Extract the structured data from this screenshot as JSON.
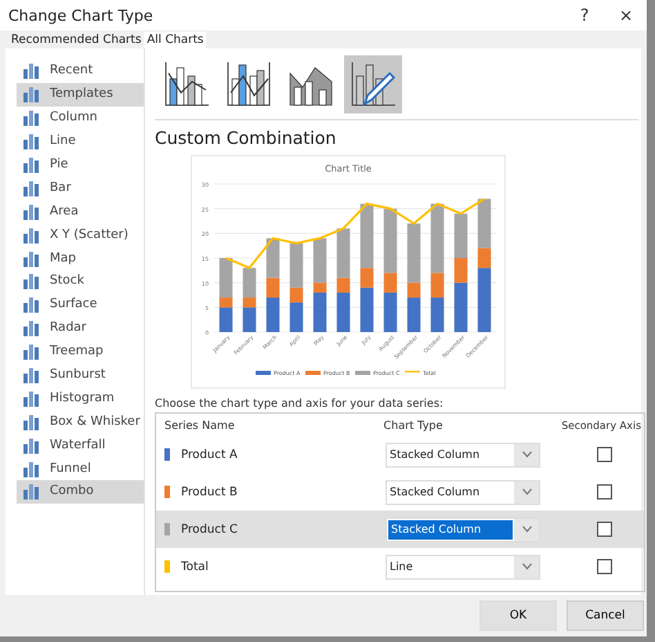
{
  "window": {
    "title": "Change Chart Type",
    "help": "?",
    "close": "×"
  },
  "tabs": [
    {
      "label": "Recommended Charts",
      "selected": false
    },
    {
      "label": "All Charts",
      "selected": true
    }
  ],
  "sidebar": {
    "items": [
      {
        "label": "Recent",
        "selected": false
      },
      {
        "label": "Templates",
        "selected": true
      },
      {
        "label": "Column",
        "selected": false
      },
      {
        "label": "Line",
        "selected": false
      },
      {
        "label": "Pie",
        "selected": false
      },
      {
        "label": "Bar",
        "selected": false
      },
      {
        "label": "Area",
        "selected": false
      },
      {
        "label": "X Y (Scatter)",
        "selected": false
      },
      {
        "label": "Map",
        "selected": false
      },
      {
        "label": "Stock",
        "selected": false
      },
      {
        "label": "Surface",
        "selected": false
      },
      {
        "label": "Radar",
        "selected": false
      },
      {
        "label": "Treemap",
        "selected": false
      },
      {
        "label": "Sunburst",
        "selected": false
      },
      {
        "label": "Histogram",
        "selected": false
      },
      {
        "label": "Box & Whisker",
        "selected": false
      },
      {
        "label": "Waterfall",
        "selected": false
      },
      {
        "label": "Funnel",
        "selected": false
      },
      {
        "label": "Combo",
        "selected": true
      }
    ]
  },
  "subtypes": [
    {
      "kind": "column-line",
      "selected": false
    },
    {
      "kind": "column-line-secondary",
      "selected": false
    },
    {
      "kind": "area-column",
      "selected": false
    },
    {
      "kind": "custom",
      "selected": true
    }
  ],
  "heading": "Custom Combination",
  "preview": {
    "chart_data": {
      "type": "bar",
      "stacked": true,
      "title": "Chart Title",
      "categories": [
        "January",
        "February",
        "March",
        "April",
        "May",
        "June",
        "July",
        "August",
        "September",
        "October",
        "November",
        "December"
      ],
      "series": [
        {
          "name": "Product A",
          "color": "#4472c4",
          "values": [
            5,
            5,
            7,
            6,
            8,
            8,
            9,
            8,
            7,
            7,
            10,
            13
          ]
        },
        {
          "name": "Product B",
          "color": "#ed7d31",
          "values": [
            2,
            2,
            4,
            3,
            2,
            3,
            4,
            4,
            3,
            5,
            5,
            4
          ]
        },
        {
          "name": "Product C",
          "color": "#a5a5a5",
          "values": [
            8,
            6,
            8,
            9,
            9,
            10,
            13,
            13,
            12,
            14,
            9,
            10
          ]
        },
        {
          "name": "Total",
          "color": "#ffc000",
          "type": "line",
          "values": [
            15,
            13,
            19,
            18,
            19,
            21,
            26,
            25,
            22,
            26,
            24,
            27
          ]
        }
      ],
      "ylim": [
        0,
        30
      ],
      "yticks": [
        0,
        5,
        10,
        15,
        20,
        25,
        30
      ],
      "grid": true,
      "legend": true
    }
  },
  "series_table": {
    "prompt": "Choose the chart type and axis for your data series:",
    "columns": [
      "Series Name",
      "Chart Type",
      "Secondary Axis"
    ],
    "rows": [
      {
        "name": "Product A",
        "color": "#4472c4",
        "chart_type": "Stacked Column",
        "secondary_axis": false,
        "selected": false
      },
      {
        "name": "Product B",
        "color": "#ed7d31",
        "chart_type": "Stacked Column",
        "secondary_axis": false,
        "selected": false
      },
      {
        "name": "Product C",
        "color": "#a5a5a5",
        "chart_type": "Stacked Column",
        "secondary_axis": false,
        "selected": true
      },
      {
        "name": "Total",
        "color": "#ffc000",
        "chart_type": "Line",
        "secondary_axis": false,
        "selected": false
      }
    ]
  },
  "buttons": [
    {
      "label": "OK",
      "default": true
    },
    {
      "label": "Cancel",
      "default": false
    }
  ]
}
